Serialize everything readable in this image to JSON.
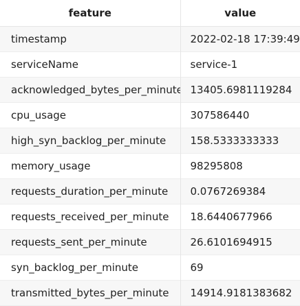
{
  "table": {
    "headers": [
      "feature",
      "value"
    ],
    "rows": [
      {
        "feature": "timestamp",
        "value": "2022-02-18 17:39:49"
      },
      {
        "feature": "serviceName",
        "value": "service-1"
      },
      {
        "feature": "acknowledged_bytes_per_minute",
        "value": "13405.6981119284"
      },
      {
        "feature": "cpu_usage",
        "value": "307586440"
      },
      {
        "feature": "high_syn_backlog_per_minute",
        "value": "158.5333333333"
      },
      {
        "feature": "memory_usage",
        "value": "98295808"
      },
      {
        "feature": "requests_duration_per_minute",
        "value": "0.0767269384"
      },
      {
        "feature": "requests_received_per_minute",
        "value": "18.6440677966"
      },
      {
        "feature": "requests_sent_per_minute",
        "value": "26.6101694915"
      },
      {
        "feature": "syn_backlog_per_minute",
        "value": "69"
      },
      {
        "feature": "transmitted_bytes_per_minute",
        "value": "14914.9181383682"
      }
    ]
  }
}
